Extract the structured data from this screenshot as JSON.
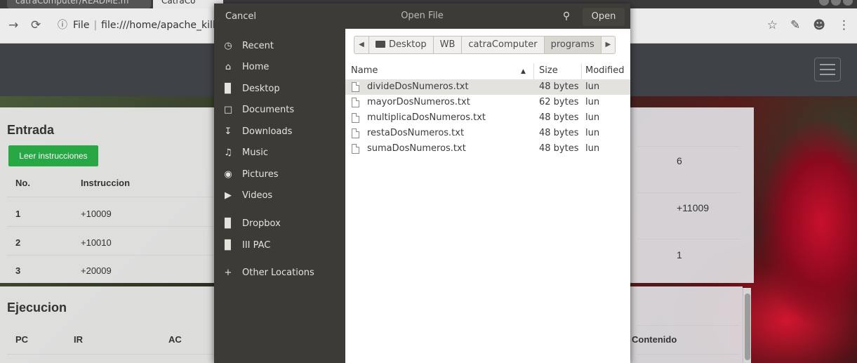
{
  "browser": {
    "tabs": [
      {
        "label": "catraComputer/README.m"
      },
      {
        "label": "CatraCo"
      }
    ],
    "url": {
      "info": "File",
      "address": "file:///home/apache_killer"
    }
  },
  "page": {
    "entrada": {
      "title": "Entrada",
      "button_label": "Leer instrucciones",
      "headers": [
        "No.",
        "Instruccion"
      ],
      "rows": [
        {
          "no": "1",
          "instr": "+10009"
        },
        {
          "no": "2",
          "instr": "+10010"
        },
        {
          "no": "3",
          "instr": "+20009"
        }
      ]
    },
    "right_panel": {
      "values": [
        "6",
        "+11009",
        "1"
      ]
    },
    "ejecucion": {
      "title": "Ejecucion",
      "headers": [
        "PC",
        "IR",
        "AC"
      ],
      "contenido_header": "Contenido"
    }
  },
  "dialog": {
    "cancel_label": "Cancel",
    "title": "Open File",
    "open_label": "Open",
    "sidebar": [
      {
        "label": "Recent",
        "icon": "clock-icon"
      },
      {
        "label": "Home",
        "icon": "home-icon"
      },
      {
        "label": "Desktop",
        "icon": "folder-icon"
      },
      {
        "label": "Documents",
        "icon": "document-icon"
      },
      {
        "label": "Downloads",
        "icon": "download-icon"
      },
      {
        "label": "Music",
        "icon": "music-icon"
      },
      {
        "label": "Pictures",
        "icon": "camera-icon"
      },
      {
        "label": "Videos",
        "icon": "video-icon"
      },
      {
        "label": "Dropbox",
        "icon": "folder-icon"
      },
      {
        "label": "III PAC",
        "icon": "folder-icon"
      },
      {
        "label": "Other Locations",
        "icon": "plus-icon"
      }
    ],
    "path": [
      "Desktop",
      "WB",
      "catraComputer",
      "programs"
    ],
    "columns": {
      "name": "Name",
      "size": "Size",
      "modified": "Modified"
    },
    "files": [
      {
        "name": "divideDosNumeros.txt",
        "size": "48 bytes",
        "modified": "lun"
      },
      {
        "name": "mayorDosNumeros.txt",
        "size": "62 bytes",
        "modified": "lun"
      },
      {
        "name": "multiplicaDosNumeros.txt",
        "size": "48 bytes",
        "modified": "lun"
      },
      {
        "name": "restaDosNumeros.txt",
        "size": "48 bytes",
        "modified": "lun"
      },
      {
        "name": "sumaDosNumeros.txt",
        "size": "48 bytes",
        "modified": "lun"
      }
    ]
  },
  "colors": {
    "dialog_dark": "#3c3b37",
    "button_green": "#28a745",
    "navbar": "#3f4247"
  }
}
